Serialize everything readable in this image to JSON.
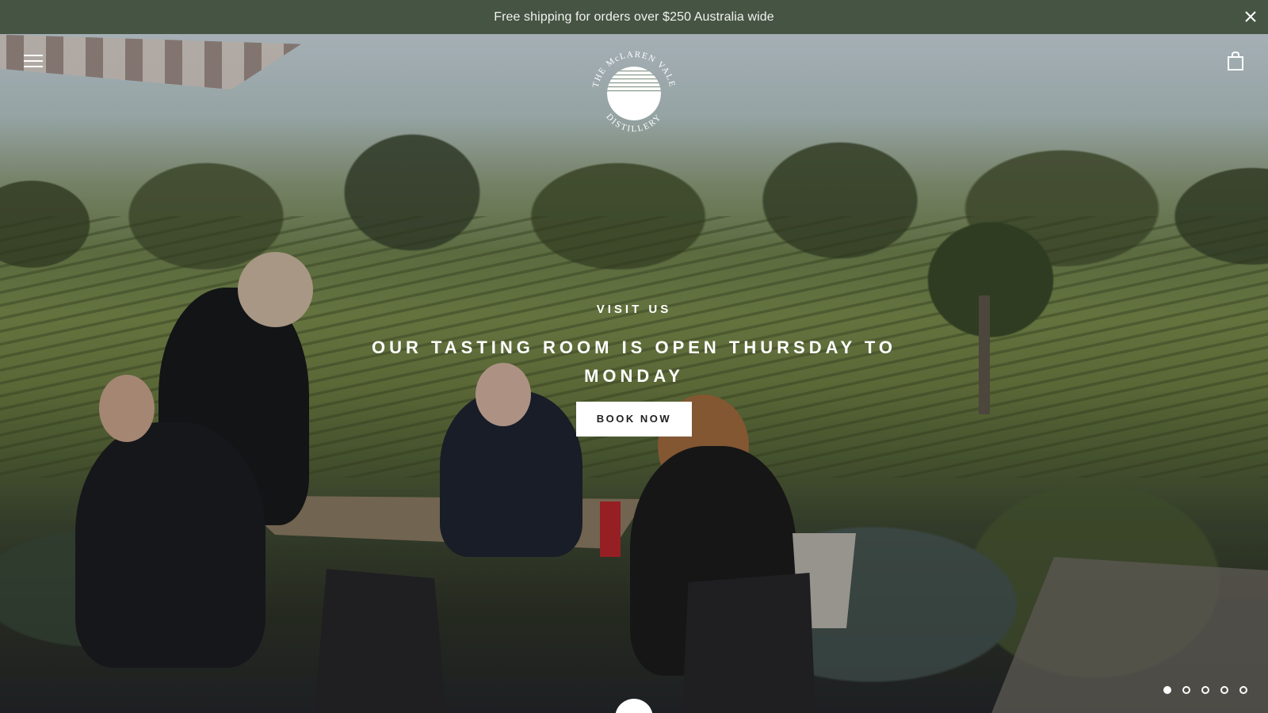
{
  "announcement": {
    "text": "Free shipping for orders over $250 Australia wide",
    "close_icon": "close-icon"
  },
  "header": {
    "menu_icon": "hamburger-menu-icon",
    "logo_text_top": "THE McLAREN VALE",
    "logo_text_bottom": "DISTILLERY",
    "cart_icon": "shopping-bag-icon"
  },
  "hero": {
    "eyebrow": "VISIT US",
    "headline": "OUR TASTING ROOM IS OPEN THURSDAY TO MONDAY",
    "cta_label": "BOOK NOW",
    "slides_total": 5,
    "active_slide": 1
  },
  "colors": {
    "announcement_bg": "#465444",
    "announcement_text": "#f2f2ee",
    "cta_bg": "#ffffff",
    "cta_text": "#1f1f1f"
  }
}
